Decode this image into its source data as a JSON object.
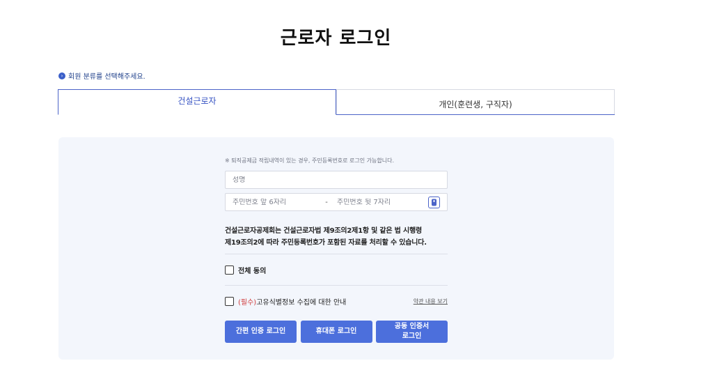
{
  "header": {
    "title": "근로자 로그인"
  },
  "member_type": {
    "hint": "회원 분류를 선택해주세요.",
    "tabs": [
      {
        "label": "건설근로자",
        "active": true
      },
      {
        "label": "개인(훈련생, 구직자)",
        "active": false
      }
    ]
  },
  "form": {
    "notice": "※ 퇴직공제금 적립내역이 있는 경우, 주민등록번호로 로그인 가능합니다.",
    "name_placeholder": "성명",
    "rrn_front_placeholder": "주민번호 앞 6자리",
    "rrn_separator": "-",
    "rrn_back_placeholder": "주민번호 뒷 7자리",
    "legal_line1": "건설근로자공제회는 건설근로자법 제9조의2제1항 및 같은 법 시행령",
    "legal_line2": "제19조의2에 따라 주민등록번호가 포함된 자료를 처리할 수 있습니다.",
    "agree_all_label": "전체 동의",
    "required_tag": "(필수)",
    "unique_id_label": "고유식별정보 수집에 대한 안내",
    "terms_link": "약관 내용 보기"
  },
  "buttons": {
    "simple_auth": "간편 인증 로그인",
    "phone": "휴대폰 로그인",
    "cert": "공동 인증서\n로그인"
  },
  "colors": {
    "accent": "#4c6fdc",
    "tab_border": "#4b63c8",
    "panel_bg": "#f3f6fc",
    "required": "#d03a3a"
  }
}
